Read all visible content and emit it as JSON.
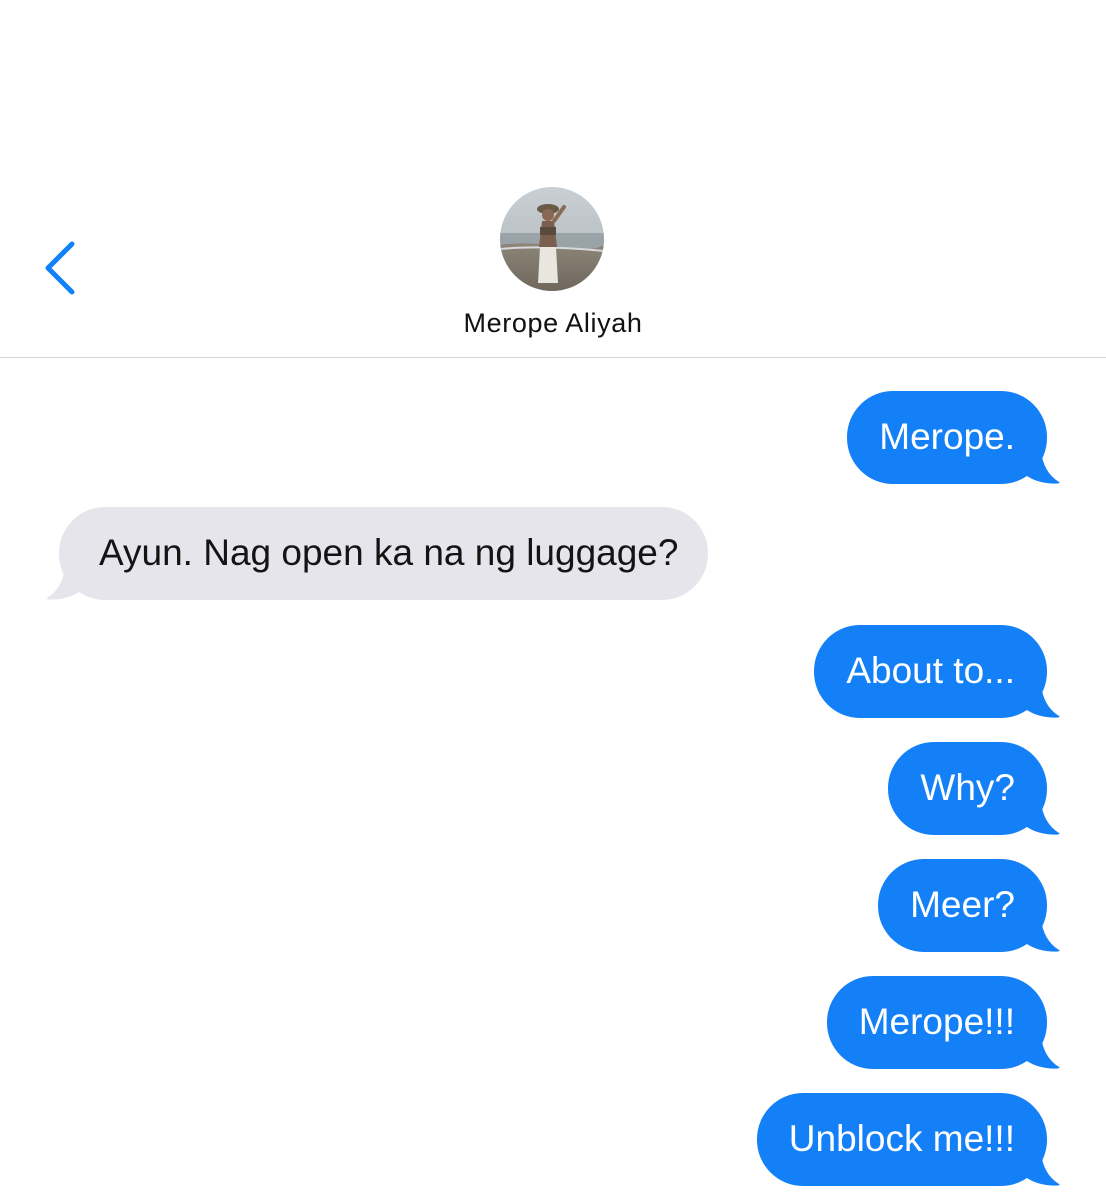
{
  "header": {
    "contact_name": "Merope Aliyah",
    "back_icon": "chevron-left-icon",
    "avatar": "contact-avatar-photo"
  },
  "colors": {
    "accent": "#1480f8",
    "sent_bubble": "#1480f8",
    "received_bubble": "#e6e5eb",
    "divider": "#d6d6d9"
  },
  "messages": [
    {
      "direction": "sent",
      "text": "Merope."
    },
    {
      "direction": "received",
      "text": "Ayun. Nag open ka na ng luggage?"
    },
    {
      "direction": "sent",
      "text": "About to..."
    },
    {
      "direction": "sent",
      "text": "Why?"
    },
    {
      "direction": "sent",
      "text": "Meer?"
    },
    {
      "direction": "sent",
      "text": "Merope!!!"
    },
    {
      "direction": "sent",
      "text": "Unblock me!!!"
    }
  ]
}
